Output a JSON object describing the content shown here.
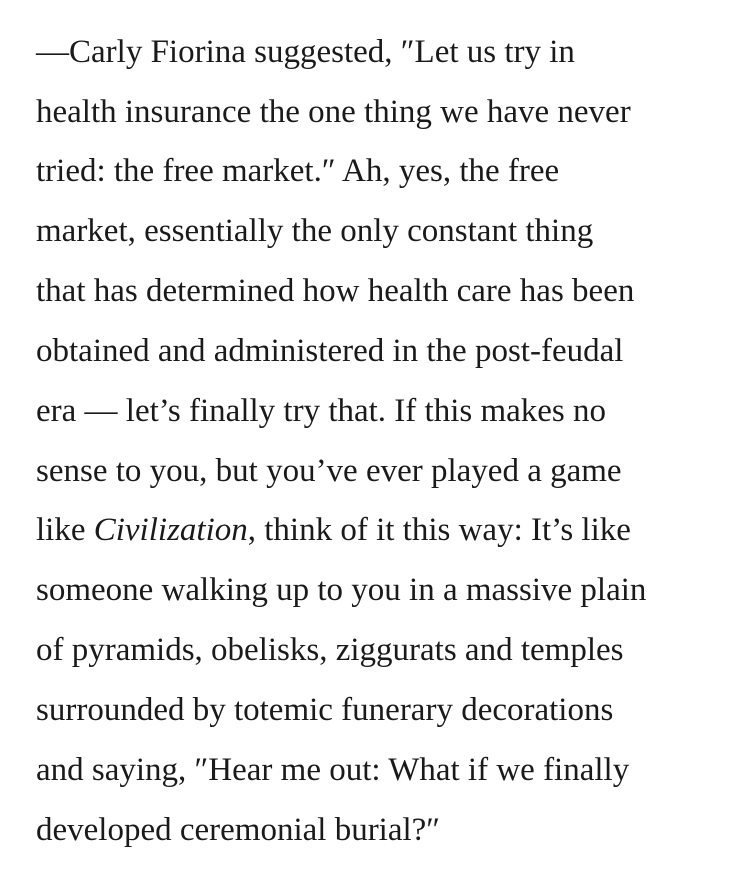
{
  "article": {
    "lines": [
      {
        "text": "—Carly Fiorina suggested, ″Let us try in"
      },
      {
        "text": "health insurance the one thing we have never"
      },
      {
        "text": "tried: the free market.″ Ah, yes, the free"
      },
      {
        "text": "market, essentially the only constant thing"
      },
      {
        "text": "that has determined how health care has been"
      },
      {
        "text": "obtained and administered in the post-feudal"
      },
      {
        "text": "era — let’s finally try that. If this makes no"
      },
      {
        "text": "sense to you, but you’ve ever played a game"
      },
      {
        "pre": "like ",
        "em": "Civilization",
        "post": ", think of it this way: It’s like"
      },
      {
        "text": "someone walking up to you in a massive plain"
      },
      {
        "text": "of pyramids, obelisks, ziggurats and temples"
      },
      {
        "text": "surrounded by totemic funerary decorations"
      },
      {
        "text": "and saying, ″Hear me out: What if we finally"
      },
      {
        "text": "developed ceremonial burial?″"
      }
    ]
  }
}
